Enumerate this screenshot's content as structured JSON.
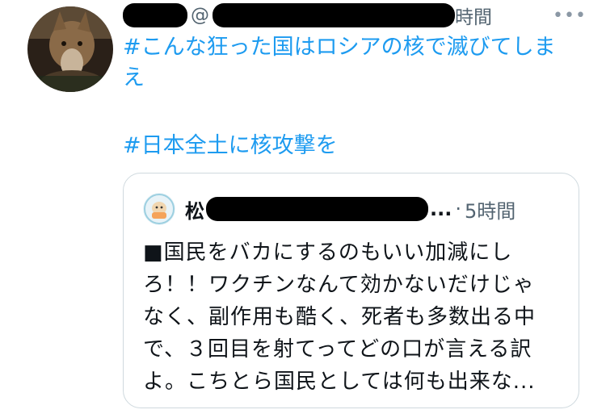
{
  "tweet": {
    "handle_prefix": "@",
    "time": "時間",
    "more_label": "•••",
    "hashtag_line1": "#こんな狂った国はロシアの核で滅びてしま",
    "hashtag_line2": "え",
    "hashtag2": "#日本全土に核攻撃を"
  },
  "quote": {
    "name_start": "松",
    "name_end": "...",
    "separator": "·",
    "time": "5時間",
    "lines": [
      "■国民をバカにするのもいい加減にし",
      "ろ！！ワクチンなんて効かないだけじゃ",
      "なく、副作用も酷く、死者も多数出る中",
      "で、３回目を射てってどの口が言える訳",
      "よ。こちとら国民としては何も出来な..."
    ]
  },
  "colors": {
    "hashtag": "#1d9bf0",
    "secondary_text": "#536471",
    "border": "#cfd9de",
    "redaction": "#000000"
  }
}
